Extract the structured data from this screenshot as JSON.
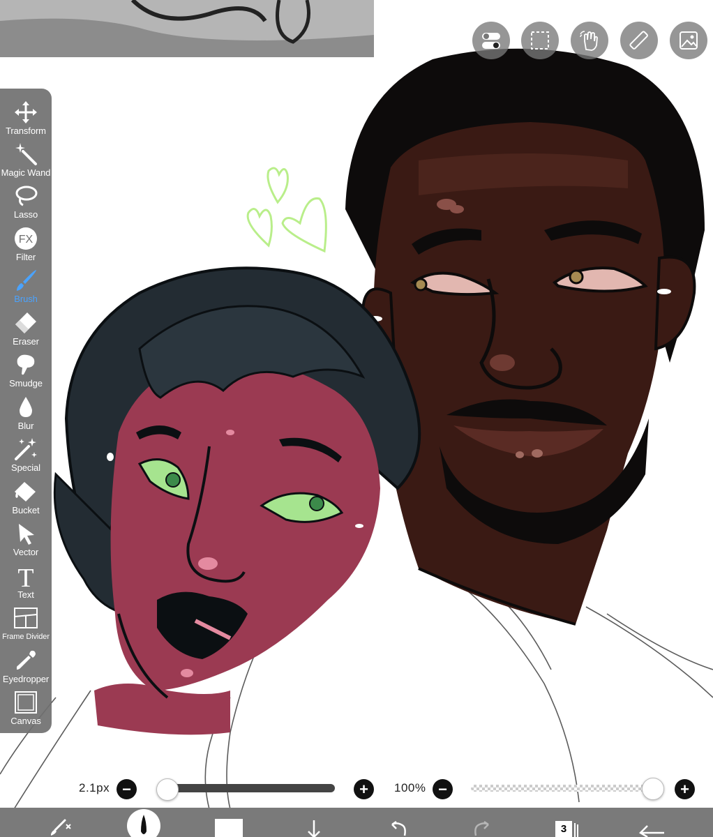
{
  "quick_actions": [
    {
      "name": "toggle-icon"
    },
    {
      "name": "selection-icon"
    },
    {
      "name": "hand-tool-icon"
    },
    {
      "name": "ruler-icon"
    },
    {
      "name": "reference-image-icon"
    }
  ],
  "toolbar": {
    "active_tool": "Brush",
    "accent_color": "#4aa3ff",
    "tools": [
      {
        "label": "Transform",
        "icon": "transform-icon"
      },
      {
        "label": "Magic Wand",
        "icon": "magic-wand-icon"
      },
      {
        "label": "Lasso",
        "icon": "lasso-icon"
      },
      {
        "label": "Filter",
        "icon": "filter-icon"
      },
      {
        "label": "Brush",
        "icon": "brush-icon"
      },
      {
        "label": "Eraser",
        "icon": "eraser-icon"
      },
      {
        "label": "Smudge",
        "icon": "smudge-icon"
      },
      {
        "label": "Blur",
        "icon": "blur-icon"
      },
      {
        "label": "Special",
        "icon": "special-icon"
      },
      {
        "label": "Bucket",
        "icon": "bucket-icon"
      },
      {
        "label": "Vector",
        "icon": "vector-icon"
      },
      {
        "label": "Text",
        "icon": "text-icon"
      },
      {
        "label": "Frame Divider",
        "icon": "frame-divider-icon"
      },
      {
        "label": "Eyedropper",
        "icon": "eyedropper-icon"
      },
      {
        "label": "Canvas",
        "icon": "canvas-icon"
      }
    ]
  },
  "brush": {
    "size_label": "2.1px",
    "size_fraction": 0.01,
    "opacity_label": "100%",
    "opacity_fraction": 1.0
  },
  "bottom_bar": {
    "layer_count": "3",
    "current_color": "#ffffff",
    "items": [
      "brush-settings-icon",
      "brush-preview",
      "color-swatch",
      "save-icon",
      "undo-icon",
      "redo-icon",
      "layers-icon",
      "back-icon"
    ]
  },
  "filter_icon_text": "FX",
  "colors": {
    "toolbar_bg": "#707070",
    "skin_dark": "#3d1a14",
    "skin_pink": "#9b3a52",
    "hair": "#232c33",
    "hearts": "#b9ee8a"
  }
}
